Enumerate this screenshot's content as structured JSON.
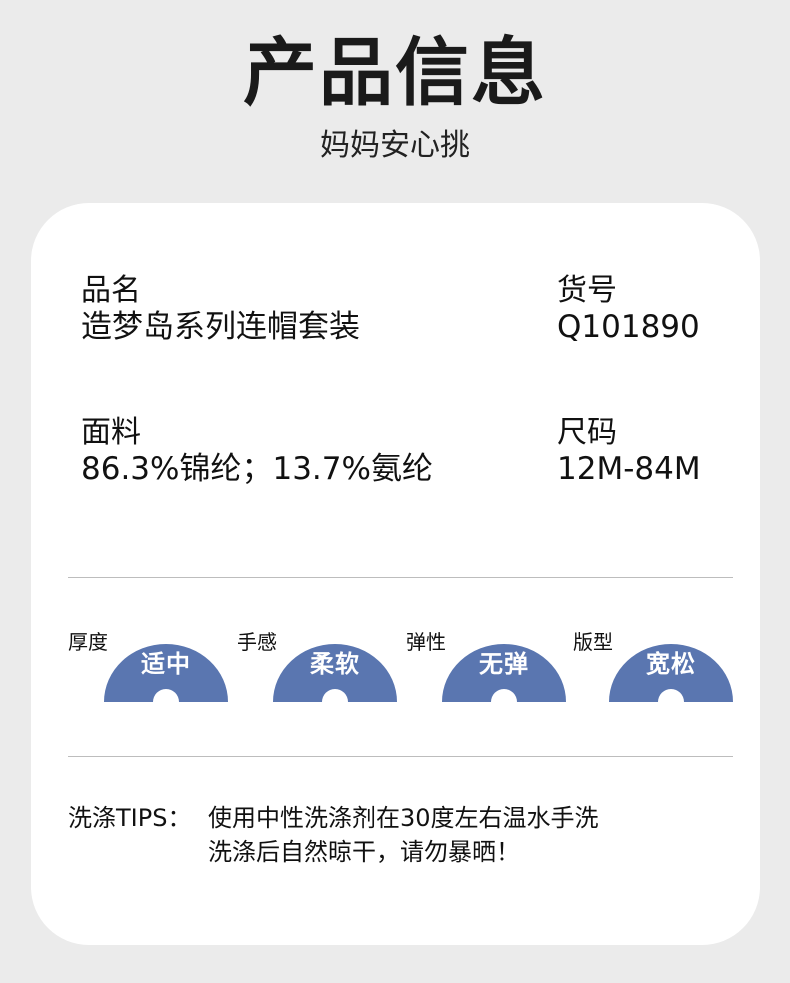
{
  "header": {
    "title": "产品信息",
    "subtitle": "妈妈安心挑"
  },
  "info": {
    "name_label": "品名",
    "name_value": "造梦岛系列连帽套装",
    "code_label": "货号",
    "code_value": "Q101890",
    "fabric_label": "面料",
    "fabric_value": "86.3%锦纶；13.7%氨纶",
    "size_label": "尺码",
    "size_value": "12M-84M"
  },
  "attributes": [
    {
      "label": "厚度",
      "value": "适中"
    },
    {
      "label": "手感",
      "value": "柔软"
    },
    {
      "label": "弹性",
      "value": "无弹"
    },
    {
      "label": "版型",
      "value": "宽松"
    }
  ],
  "tips": {
    "label": "洗涤TIPS：",
    "line1": "使用中性洗涤剂在30度左右温水手洗",
    "line2": "洗涤后自然晾干，请勿暴晒！"
  },
  "colors": {
    "badge": "#5a76b0",
    "card": "#ffffff",
    "background": "#ebebeb"
  }
}
